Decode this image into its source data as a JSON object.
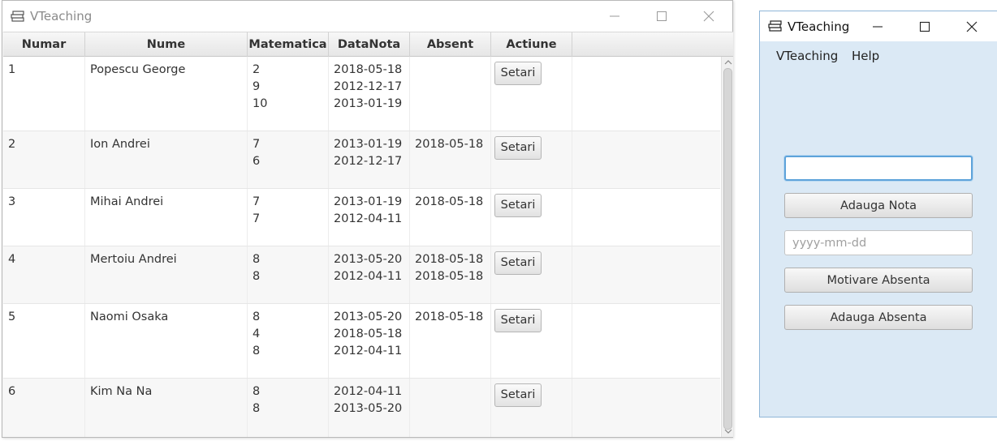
{
  "main_window": {
    "title": "VTeaching",
    "columns": [
      "Numar",
      "Nume",
      "Matematica",
      "DataNota",
      "Absent",
      "Actiune"
    ],
    "rows": [
      {
        "numar": "1",
        "nume": "Popescu George",
        "note": [
          "2",
          "9",
          "10"
        ],
        "date": [
          "2018-05-18",
          "2012-12-17",
          "2013-01-19"
        ],
        "absente": [],
        "actiune": "Setari"
      },
      {
        "numar": "2",
        "nume": "Ion Andrei",
        "note": [
          "7",
          "6"
        ],
        "date": [
          "2013-01-19",
          "2012-12-17"
        ],
        "absente": [
          "2018-05-18"
        ],
        "actiune": "Setari"
      },
      {
        "numar": "3",
        "nume": "Mihai Andrei",
        "note": [
          "7",
          "7"
        ],
        "date": [
          "2013-01-19",
          "2012-04-11"
        ],
        "absente": [
          "2018-05-18"
        ],
        "actiune": "Setari"
      },
      {
        "numar": "4",
        "nume": "Mertoiu Andrei",
        "note": [
          "8",
          "8"
        ],
        "date": [
          "2013-05-20",
          "2012-04-11"
        ],
        "absente": [
          "2018-05-18",
          "2018-05-18"
        ],
        "actiune": "Setari"
      },
      {
        "numar": "5",
        "nume": "Naomi Osaka",
        "note": [
          "8",
          "4",
          "8"
        ],
        "date": [
          "2013-05-20",
          "2018-05-18",
          "2012-04-11"
        ],
        "absente": [
          "2018-05-18"
        ],
        "actiune": "Setari"
      },
      {
        "numar": "6",
        "nume": "Kim Na Na",
        "note": [
          "8",
          "8"
        ],
        "date": [
          "2012-04-11",
          "2013-05-20"
        ],
        "absente": [],
        "actiune": "Setari"
      }
    ]
  },
  "side_window": {
    "title": "VTeaching",
    "menu": [
      "VTeaching",
      "Help"
    ],
    "nota_input": {
      "value": "",
      "placeholder": ""
    },
    "add_grade_label": "Adauga Nota",
    "date_input": {
      "value": "",
      "placeholder": "yyyy-mm-dd"
    },
    "motivate_label": "Motivare Absenta",
    "add_absence_label": "Adauga Absenta"
  },
  "icons": {
    "app": "books-icon",
    "minimize": "minimize-icon",
    "maximize": "maximize-icon",
    "close": "close-icon",
    "scroll_up": "chevron-up-icon",
    "scroll_down": "chevron-down-icon"
  },
  "colors": {
    "side_window_bg": "#dbe9f5",
    "focus_border": "#5ea3da"
  }
}
